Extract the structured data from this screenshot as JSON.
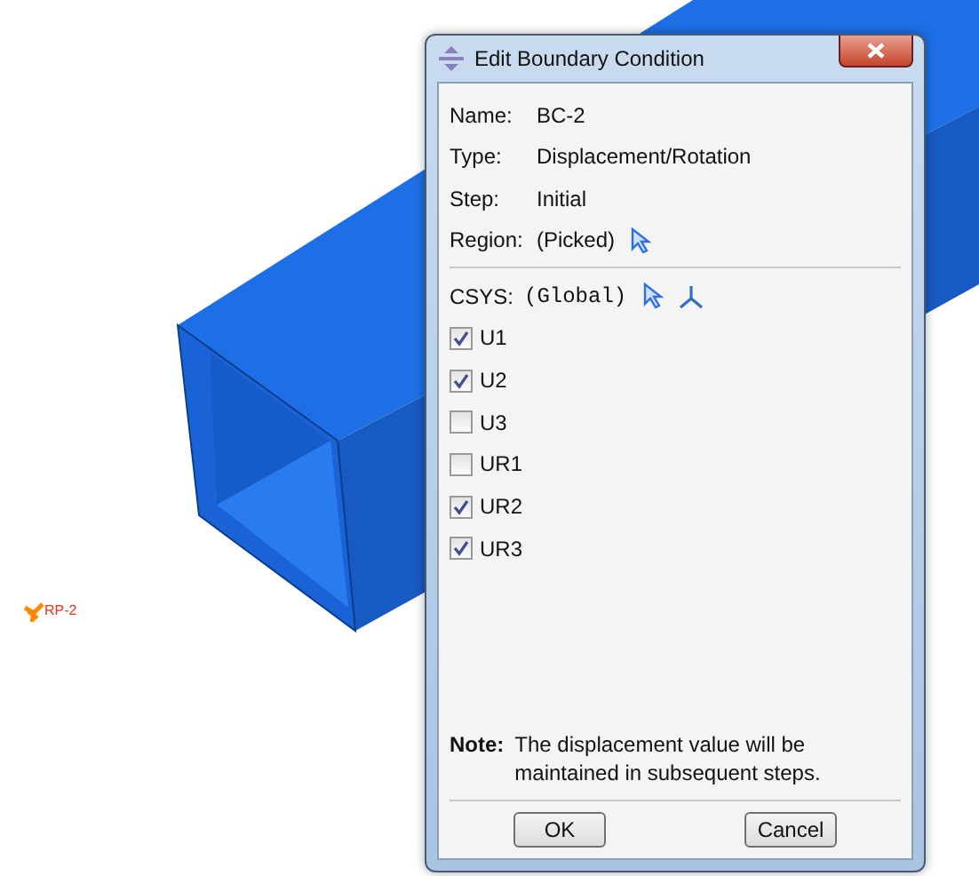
{
  "viewport": {
    "reference_point": "RP-2"
  },
  "dialog": {
    "title": "Edit Boundary Condition",
    "fields": [
      {
        "label": "Name:",
        "value": "BC-2",
        "kind": "text"
      },
      {
        "label": "Type:",
        "value": "Displacement/Rotation",
        "kind": "text"
      },
      {
        "label": "Step:",
        "value": "Initial",
        "kind": "text"
      },
      {
        "label": "Region:",
        "value": "(Picked)",
        "kind": "picker"
      }
    ],
    "csys": {
      "label": "CSYS:",
      "value": "(Global)"
    },
    "dofs": [
      {
        "label": "U1",
        "checked": true
      },
      {
        "label": "U2",
        "checked": true
      },
      {
        "label": "U3",
        "checked": false
      },
      {
        "label": "UR1",
        "checked": false
      },
      {
        "label": "UR2",
        "checked": true
      },
      {
        "label": "UR3",
        "checked": true
      }
    ],
    "note": {
      "label": "Note:",
      "text": "The displacement value will be maintained in subsequent steps."
    },
    "buttons": [
      "OK",
      "Cancel"
    ]
  }
}
